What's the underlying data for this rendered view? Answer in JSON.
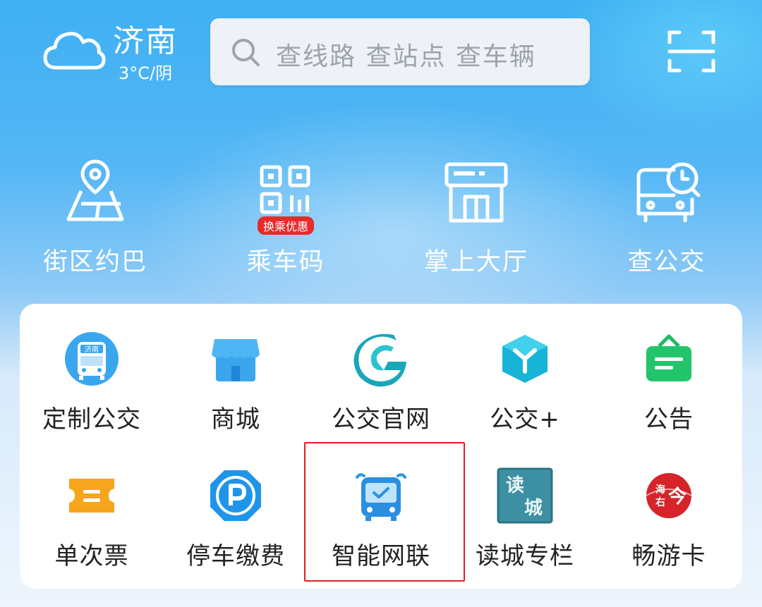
{
  "header": {
    "city": "济南",
    "weather": "3°C/阴",
    "search_placeholder": "查线路 查站点 查车辆"
  },
  "top_nav": [
    {
      "label": "街区约巴",
      "icon": "map-pin-icon"
    },
    {
      "label": "乘车码",
      "icon": "qr-code-icon",
      "badge": "换乘优惠"
    },
    {
      "label": "掌上大厅",
      "icon": "storefront-icon"
    },
    {
      "label": "查公交",
      "icon": "bus-clock-icon"
    }
  ],
  "grid": [
    {
      "label": "定制公交",
      "icon": "custom-bus-icon",
      "badge_text": "济南"
    },
    {
      "label": "商城",
      "icon": "shop-icon"
    },
    {
      "label": "公交官网",
      "icon": "official-site-logo-icon"
    },
    {
      "label": "公交+",
      "icon": "cube-icon"
    },
    {
      "label": "公告",
      "icon": "notice-board-icon"
    },
    {
      "label": "单次票",
      "icon": "ticket-icon"
    },
    {
      "label": "停车缴费",
      "icon": "parking-icon"
    },
    {
      "label": "智能网联",
      "icon": "smart-bus-icon"
    },
    {
      "label": "读城专栏",
      "icon": "read-city-icon",
      "icon_text": "读 城"
    },
    {
      "label": "畅游卡",
      "icon": "travel-card-icon",
      "icon_text": "海右 今"
    }
  ],
  "colors": {
    "accent_blue": "#3aa6ee",
    "highlight": "#e31e1e",
    "badge_red": "#e72a2a"
  }
}
